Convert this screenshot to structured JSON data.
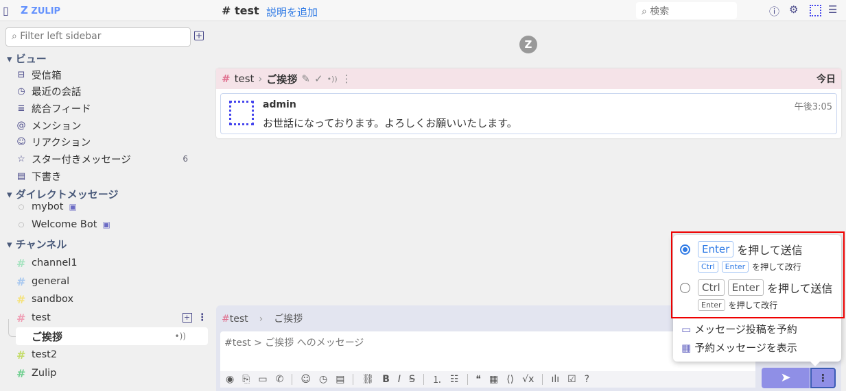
{
  "topbar": {
    "brand": "ZULIP",
    "channel": "test",
    "add_description": "説明を追加",
    "search_placeholder": "検索"
  },
  "sidebar": {
    "filter_placeholder": "Filter left sidebar",
    "views_header": "ビュー",
    "views": [
      {
        "label": "受信箱",
        "icon": "inbox-icon"
      },
      {
        "label": "最近の会話",
        "icon": "clock-icon"
      },
      {
        "label": "統合フィード",
        "icon": "feed-icon"
      },
      {
        "label": "メンション",
        "icon": "at-icon"
      },
      {
        "label": "リアクション",
        "icon": "smile-icon"
      },
      {
        "label": "スター付きメッセージ",
        "icon": "star-icon",
        "count": "6"
      },
      {
        "label": "下書き",
        "icon": "draft-icon"
      }
    ],
    "dm_header": "ダイレクトメッセージ",
    "dms": [
      "mybot",
      "Welcome Bot"
    ],
    "channels_header": "チャンネル",
    "channels": [
      {
        "name": "channel1",
        "color": "#a6e3c0"
      },
      {
        "name": "general",
        "color": "#a8c8ef"
      },
      {
        "name": "sandbox",
        "color": "#f5e27a"
      },
      {
        "name": "test",
        "color": "#ef9fb5"
      },
      {
        "name": "test2",
        "color": "#c4dc6a"
      },
      {
        "name": "Zulip",
        "color": "#6fcf8f"
      }
    ],
    "topic": "ご挨拶"
  },
  "recipient": {
    "channel": "test",
    "topic": "ご挨拶",
    "date": "今日"
  },
  "message": {
    "sender": "admin",
    "time": "午後3:05",
    "content": "お世話になっております。よろしくお願いいたします。"
  },
  "compose": {
    "channel": "test",
    "topic": "ご挨拶",
    "placeholder": "#test > ご挨拶 へのメッセージ"
  },
  "popover": {
    "opt1_key": "Enter",
    "opt1_label": "を押して送信",
    "opt1_sub_k1": "Ctrl",
    "opt1_sub_k2": "Enter",
    "opt1_sub": "を押して改行",
    "opt2_k1": "Ctrl",
    "opt2_k2": "Enter",
    "opt2_label": "を押して送信",
    "opt2_sub_k": "Enter",
    "opt2_sub": "を押して改行",
    "schedule": "メッセージ投稿を予約",
    "view_scheduled": "予約メッセージを表示",
    "selected_option": 1
  }
}
